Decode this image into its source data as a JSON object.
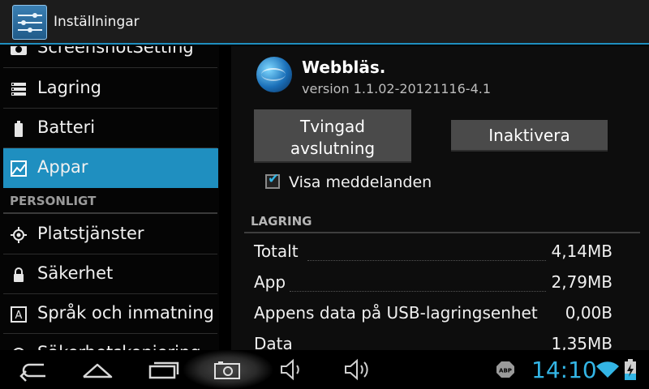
{
  "actionbar": {
    "title": "Inställningar"
  },
  "sidebar": {
    "items": [
      {
        "label": "ScreenshotSetting",
        "icon": "camera-icon"
      },
      {
        "label": "Lagring",
        "icon": "storage-icon"
      },
      {
        "label": "Batteri",
        "icon": "battery-icon"
      },
      {
        "label": "Appar",
        "icon": "apps-icon",
        "active": true
      },
      {
        "section": "PERSONLIGT"
      },
      {
        "label": "Platstjänster",
        "icon": "location-icon"
      },
      {
        "label": "Säkerhet",
        "icon": "lock-icon"
      },
      {
        "label": "Språk och inmatning",
        "icon": "language-icon"
      },
      {
        "label": "Säkerhetskopiering",
        "icon": "backup-icon"
      }
    ]
  },
  "app": {
    "name": "Webbläs.",
    "version": "version 1.1.02-20121116-4.1",
    "force_stop_label_1": "Tvingad",
    "force_stop_label_2": "avslutning",
    "disable_label": "Inaktivera",
    "notifications_label": "Visa meddelanden",
    "notifications_checked": true
  },
  "storage": {
    "header": "LAGRING",
    "rows": [
      {
        "key": "Totalt",
        "value": "4,14MB"
      },
      {
        "key": "App",
        "value": "2,79MB"
      },
      {
        "key": "Appens data på USB-lagringsenhet",
        "value": "0,00B"
      },
      {
        "key": "Data",
        "value": "1,35MB"
      }
    ]
  },
  "statusbar": {
    "time": "14:10",
    "adblock_badge": "ABP",
    "accent_color": "#33b5e5"
  },
  "colors": {
    "accent": "#1f8fc0",
    "clock": "#33b5e5"
  }
}
